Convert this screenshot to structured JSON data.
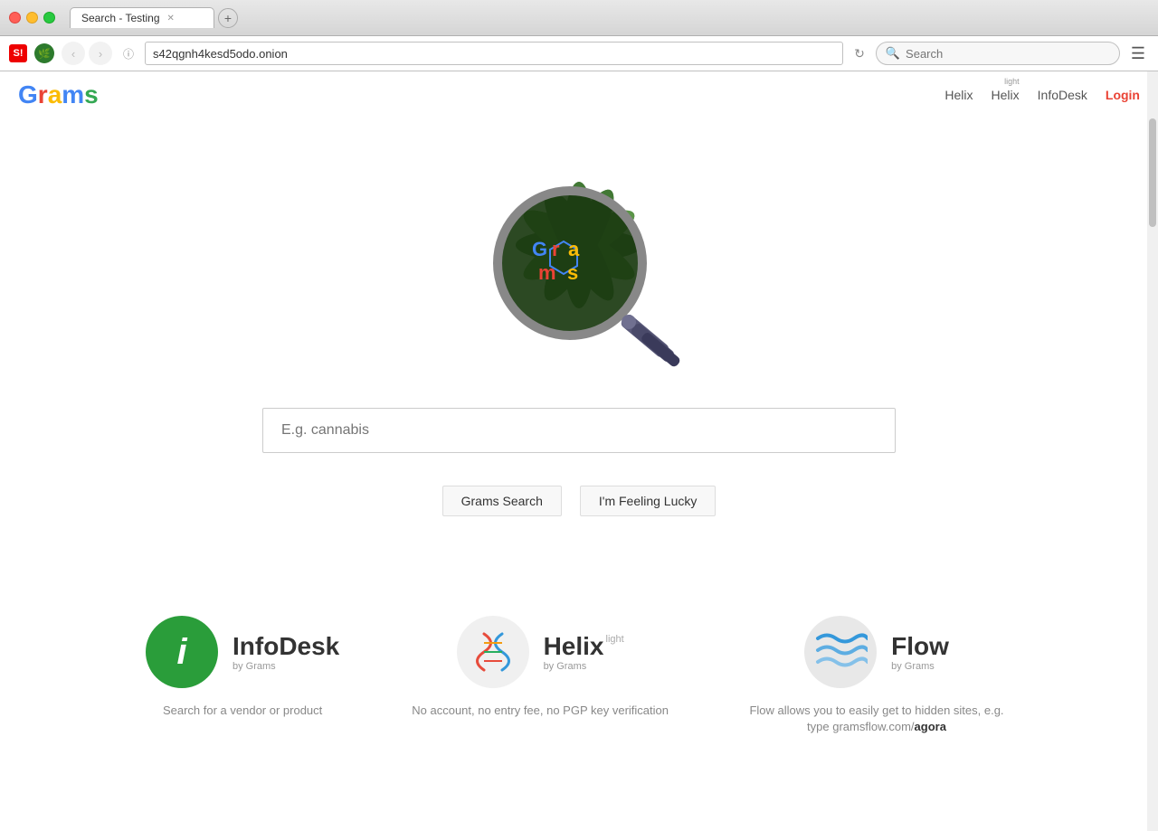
{
  "window": {
    "title": "Search - Testing"
  },
  "browser": {
    "back_disabled": true,
    "forward_disabled": true,
    "url": "s42qgnh4kesd5odo.onion",
    "search_placeholder": "Search"
  },
  "header": {
    "logo": "Grams",
    "logo_letters": {
      "G": "#4285f4",
      "r": "#ea4335",
      "a": "#fbbc05",
      "m": "#4285f4",
      "s": "#34a853"
    },
    "nav": [
      {
        "label": "Helix",
        "href": "#",
        "extra": null
      },
      {
        "label": "Helix",
        "href": "#",
        "extra": "light"
      },
      {
        "label": "InfoDesk",
        "href": "#",
        "extra": null
      },
      {
        "label": "Login",
        "href": "#",
        "class": "login"
      }
    ]
  },
  "search": {
    "placeholder": "E.g. cannabis",
    "button1": "Grams Search",
    "button2": "I'm Feeling Lucky"
  },
  "services": [
    {
      "id": "infodesk",
      "name_bold": "Info",
      "name_rest": "Desk",
      "by": "by Grams",
      "desc": "Search for a vendor or product",
      "extra_label": null
    },
    {
      "id": "helix",
      "name_bold": "Helix",
      "name_rest": "",
      "by": "by Grams",
      "desc": "No account, no entry fee, no PGP key verification",
      "extra_label": "light"
    },
    {
      "id": "flow",
      "name_bold": "Flow",
      "name_rest": "",
      "by": "by Grams",
      "desc": "Flow allows you to easily get to hidden sites, e.g. type gramsflow.com/agora",
      "extra_label": null
    }
  ]
}
